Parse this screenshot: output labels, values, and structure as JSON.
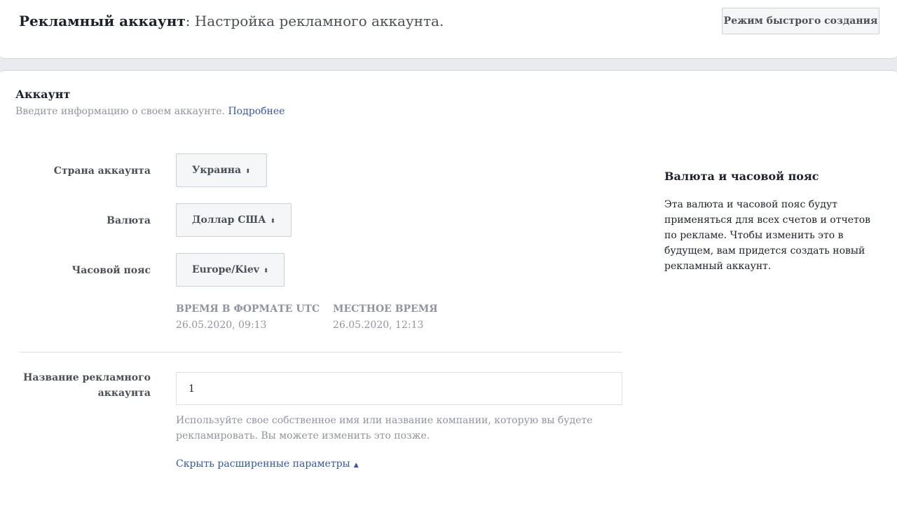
{
  "header": {
    "title_bold": "Рекламный аккаунт",
    "title_rest": ": Настройка рекламного аккаунта.",
    "quick_mode_button": "Режим быстрого создания"
  },
  "account": {
    "title": "Аккаунт",
    "subtitle": "Введите информацию о своем аккаунте.",
    "more_link": "Подробнее"
  },
  "fields": {
    "country_label": "Страна аккаунта",
    "country_value": "Украина",
    "currency_label": "Валюта",
    "currency_value": "Доллар США",
    "timezone_label": "Часовой пояс",
    "timezone_value": "Europe/Kiev"
  },
  "time": {
    "utc_header": "ВРЕМЯ В ФОРМАТЕ UTC",
    "utc_value": "26.05.2020, 09:13",
    "local_header": "МЕСТНОЕ ВРЕМЯ",
    "local_value": "26.05.2020, 12:13"
  },
  "ad_account_name": {
    "label_line1": "Название рекламного",
    "label_line2": "аккаунта",
    "value": "1",
    "hint": "Используйте свое собственное имя или название компании, которую вы будете рекламировать. Вы можете изменить это позже."
  },
  "advanced_link": "Скрыть расширенные параметры",
  "sidebar": {
    "title": "Валюта и часовой пояс",
    "text": "Эта валюта и часовой пояс будут применяться для всех счетов и отчетов по рекламе. Чтобы изменить это в будущем, вам придется создать новый рекламный аккаунт."
  },
  "colors": {
    "link": "#365899",
    "muted": "#90949c",
    "label": "#4b4f56",
    "background": "#e9ebee"
  }
}
